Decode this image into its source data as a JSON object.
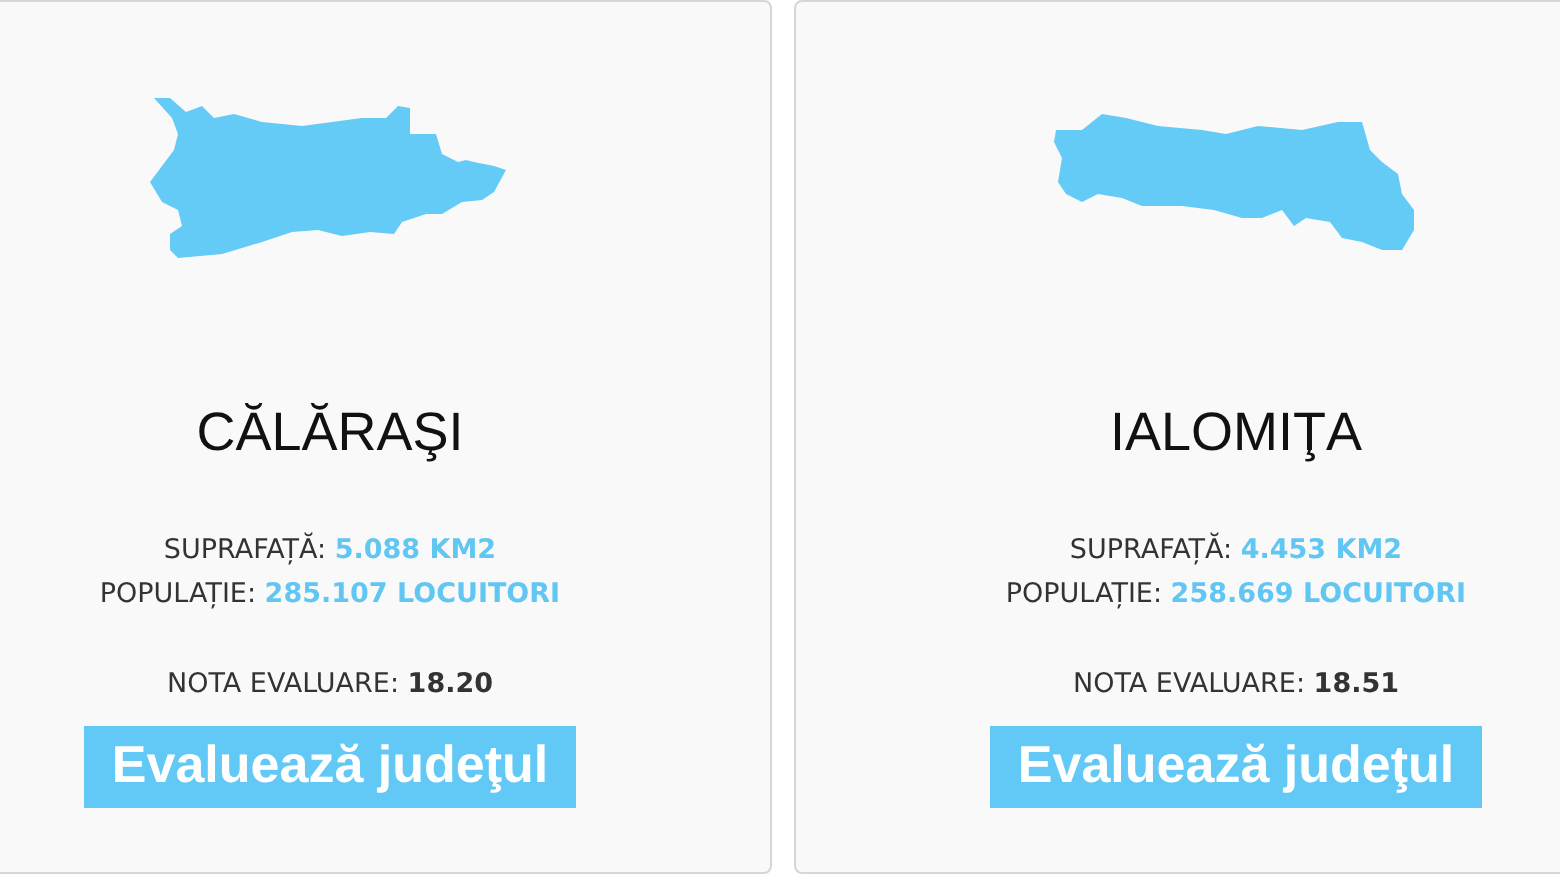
{
  "counties": [
    {
      "name": "CĂLĂRAŞI",
      "stats": [
        {
          "label": "SUPRAFAȚĂ:",
          "value": "5.088 KM2"
        },
        {
          "label": "POPULAȚIE:",
          "value": "285.107 LOCUITORI"
        }
      ],
      "score_label": "NOTA EVALUARE:",
      "score": "18.20",
      "button": "Evaluează judeţul"
    },
    {
      "name": "IALOMIŢA",
      "stats": [
        {
          "label": "SUPRAFAȚĂ:",
          "value": "4.453 KM2"
        },
        {
          "label": "POPULAȚIE:",
          "value": "258.669 LOCUITORI"
        }
      ],
      "score_label": "NOTA EVALUARE:",
      "score": "18.51",
      "button": "Evaluează judeţul"
    }
  ]
}
